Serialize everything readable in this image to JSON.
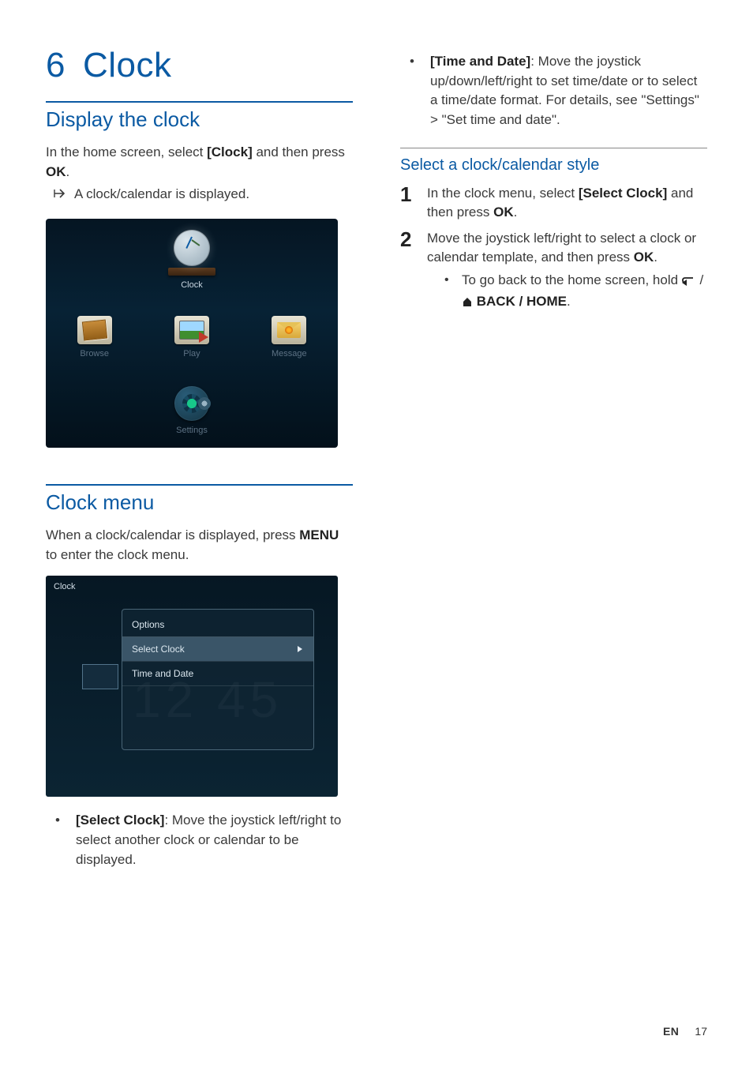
{
  "chapter": {
    "number": "6",
    "title": "Clock"
  },
  "left": {
    "sectionA": {
      "title": "Display the clock",
      "p1_a": "In the home screen, select ",
      "p1_b": "[Clock]",
      "p1_c": " and then press ",
      "p1_d": "OK",
      "p1_e": ".",
      "result": "A clock/calendar is displayed."
    },
    "homeTiles": {
      "clock": "Clock",
      "browse": "Browse",
      "play": "Play",
      "message": "Message",
      "settings": "Settings"
    },
    "sectionB": {
      "title": "Clock menu",
      "p1_a": "When a clock/calendar is displayed, press ",
      "p1_b": "MENU",
      "p1_c": " to enter the clock menu."
    },
    "menuShot": {
      "crumb": "Clock",
      "header": "Options",
      "row1": "Select Clock",
      "row2": "Time and Date",
      "bgDigits": "12 45"
    },
    "bullet1": {
      "label": "[Select Clock]",
      "text": ": Move the joystick left/right to select another clock or calendar to be displayed."
    }
  },
  "right": {
    "bullet2": {
      "label": "[Time and Date]",
      "text": ": Move the joystick up/down/left/right to set time/date or to select a time/date format. For details, see \"Settings\" > \"Set time and date\"."
    },
    "subTitle": "Select a clock/calendar style",
    "step1": {
      "a": "In the clock menu, select ",
      "b": "[Select Clock]",
      "c": " and then press ",
      "d": "OK",
      "e": "."
    },
    "step2": {
      "a": "Move the joystick left/right to select a clock or calendar template, and then press ",
      "b": "OK",
      "c": "."
    },
    "step2sub": {
      "a": "To go back to the home screen, hold ",
      "b": " / ",
      "c": " BACK / HOME",
      "d": "."
    }
  },
  "footer": {
    "lang": "EN",
    "page": "17"
  }
}
